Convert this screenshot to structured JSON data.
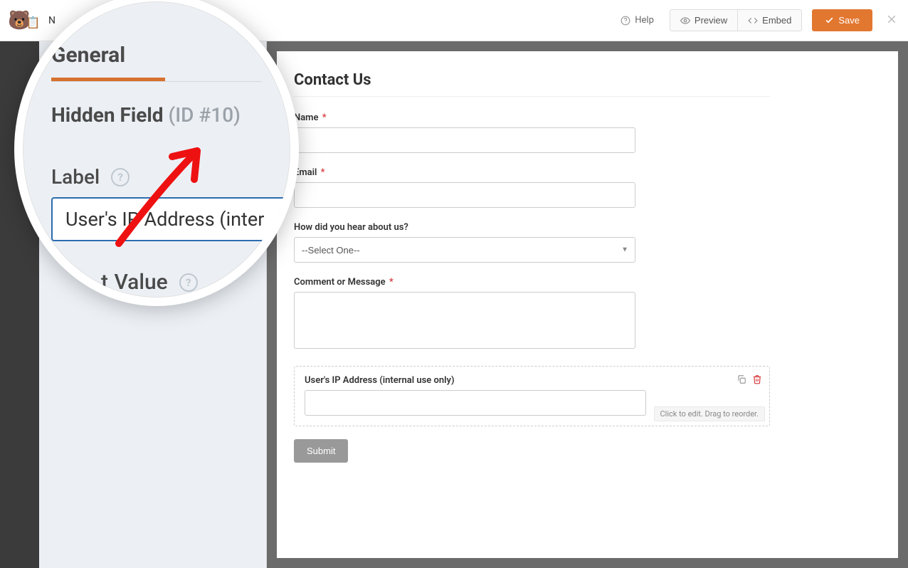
{
  "topbar": {
    "now_text": "N",
    "help": "Help",
    "preview": "Preview",
    "embed": "Embed",
    "save": "Save"
  },
  "zoom": {
    "tab": "General",
    "heading": "Hidden Field",
    "id_label": "(ID #10)",
    "label_text": "Label",
    "input_value": "User's IP Address (inter",
    "value_text": "Value"
  },
  "form": {
    "title": "Contact Us",
    "name": {
      "label": "Name"
    },
    "email": {
      "label": "Email"
    },
    "hear": {
      "label": "How did you hear about us?",
      "placeholder": "--Select One--"
    },
    "comment": {
      "label": "Comment or Message"
    },
    "hidden": {
      "label": "User's IP Address (internal use only)",
      "hint": "Click to edit. Drag to reorder."
    },
    "submit": "Submit"
  }
}
